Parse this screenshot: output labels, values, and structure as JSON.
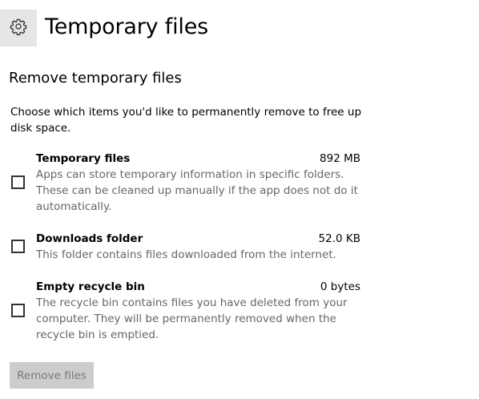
{
  "header": {
    "icon": "gear-icon",
    "title": "Temporary files"
  },
  "section": {
    "title": "Remove temporary files",
    "intro": "Choose which items you'd like to permanently remove to free up disk space."
  },
  "items": [
    {
      "name": "Temporary files",
      "size": "892 MB",
      "description": "Apps can store temporary information in specific folders. These can be cleaned up manually if the app does not do it automatically.",
      "checked": false
    },
    {
      "name": "Downloads folder",
      "size": "52.0 KB",
      "description": "This folder contains files downloaded from the internet.",
      "checked": false
    },
    {
      "name": "Empty recycle bin",
      "size": "0 bytes",
      "description": "The recycle bin contains files you have deleted from your computer. They will be permanently removed when the recycle bin is emptied.",
      "checked": false
    }
  ],
  "actions": {
    "remove_label": "Remove files",
    "remove_enabled": false
  },
  "colors": {
    "header_icon_bg": "#e6e6e6",
    "description_text": "#666666",
    "disabled_button_bg": "#cccccc",
    "disabled_button_text": "#7a7a7a"
  }
}
